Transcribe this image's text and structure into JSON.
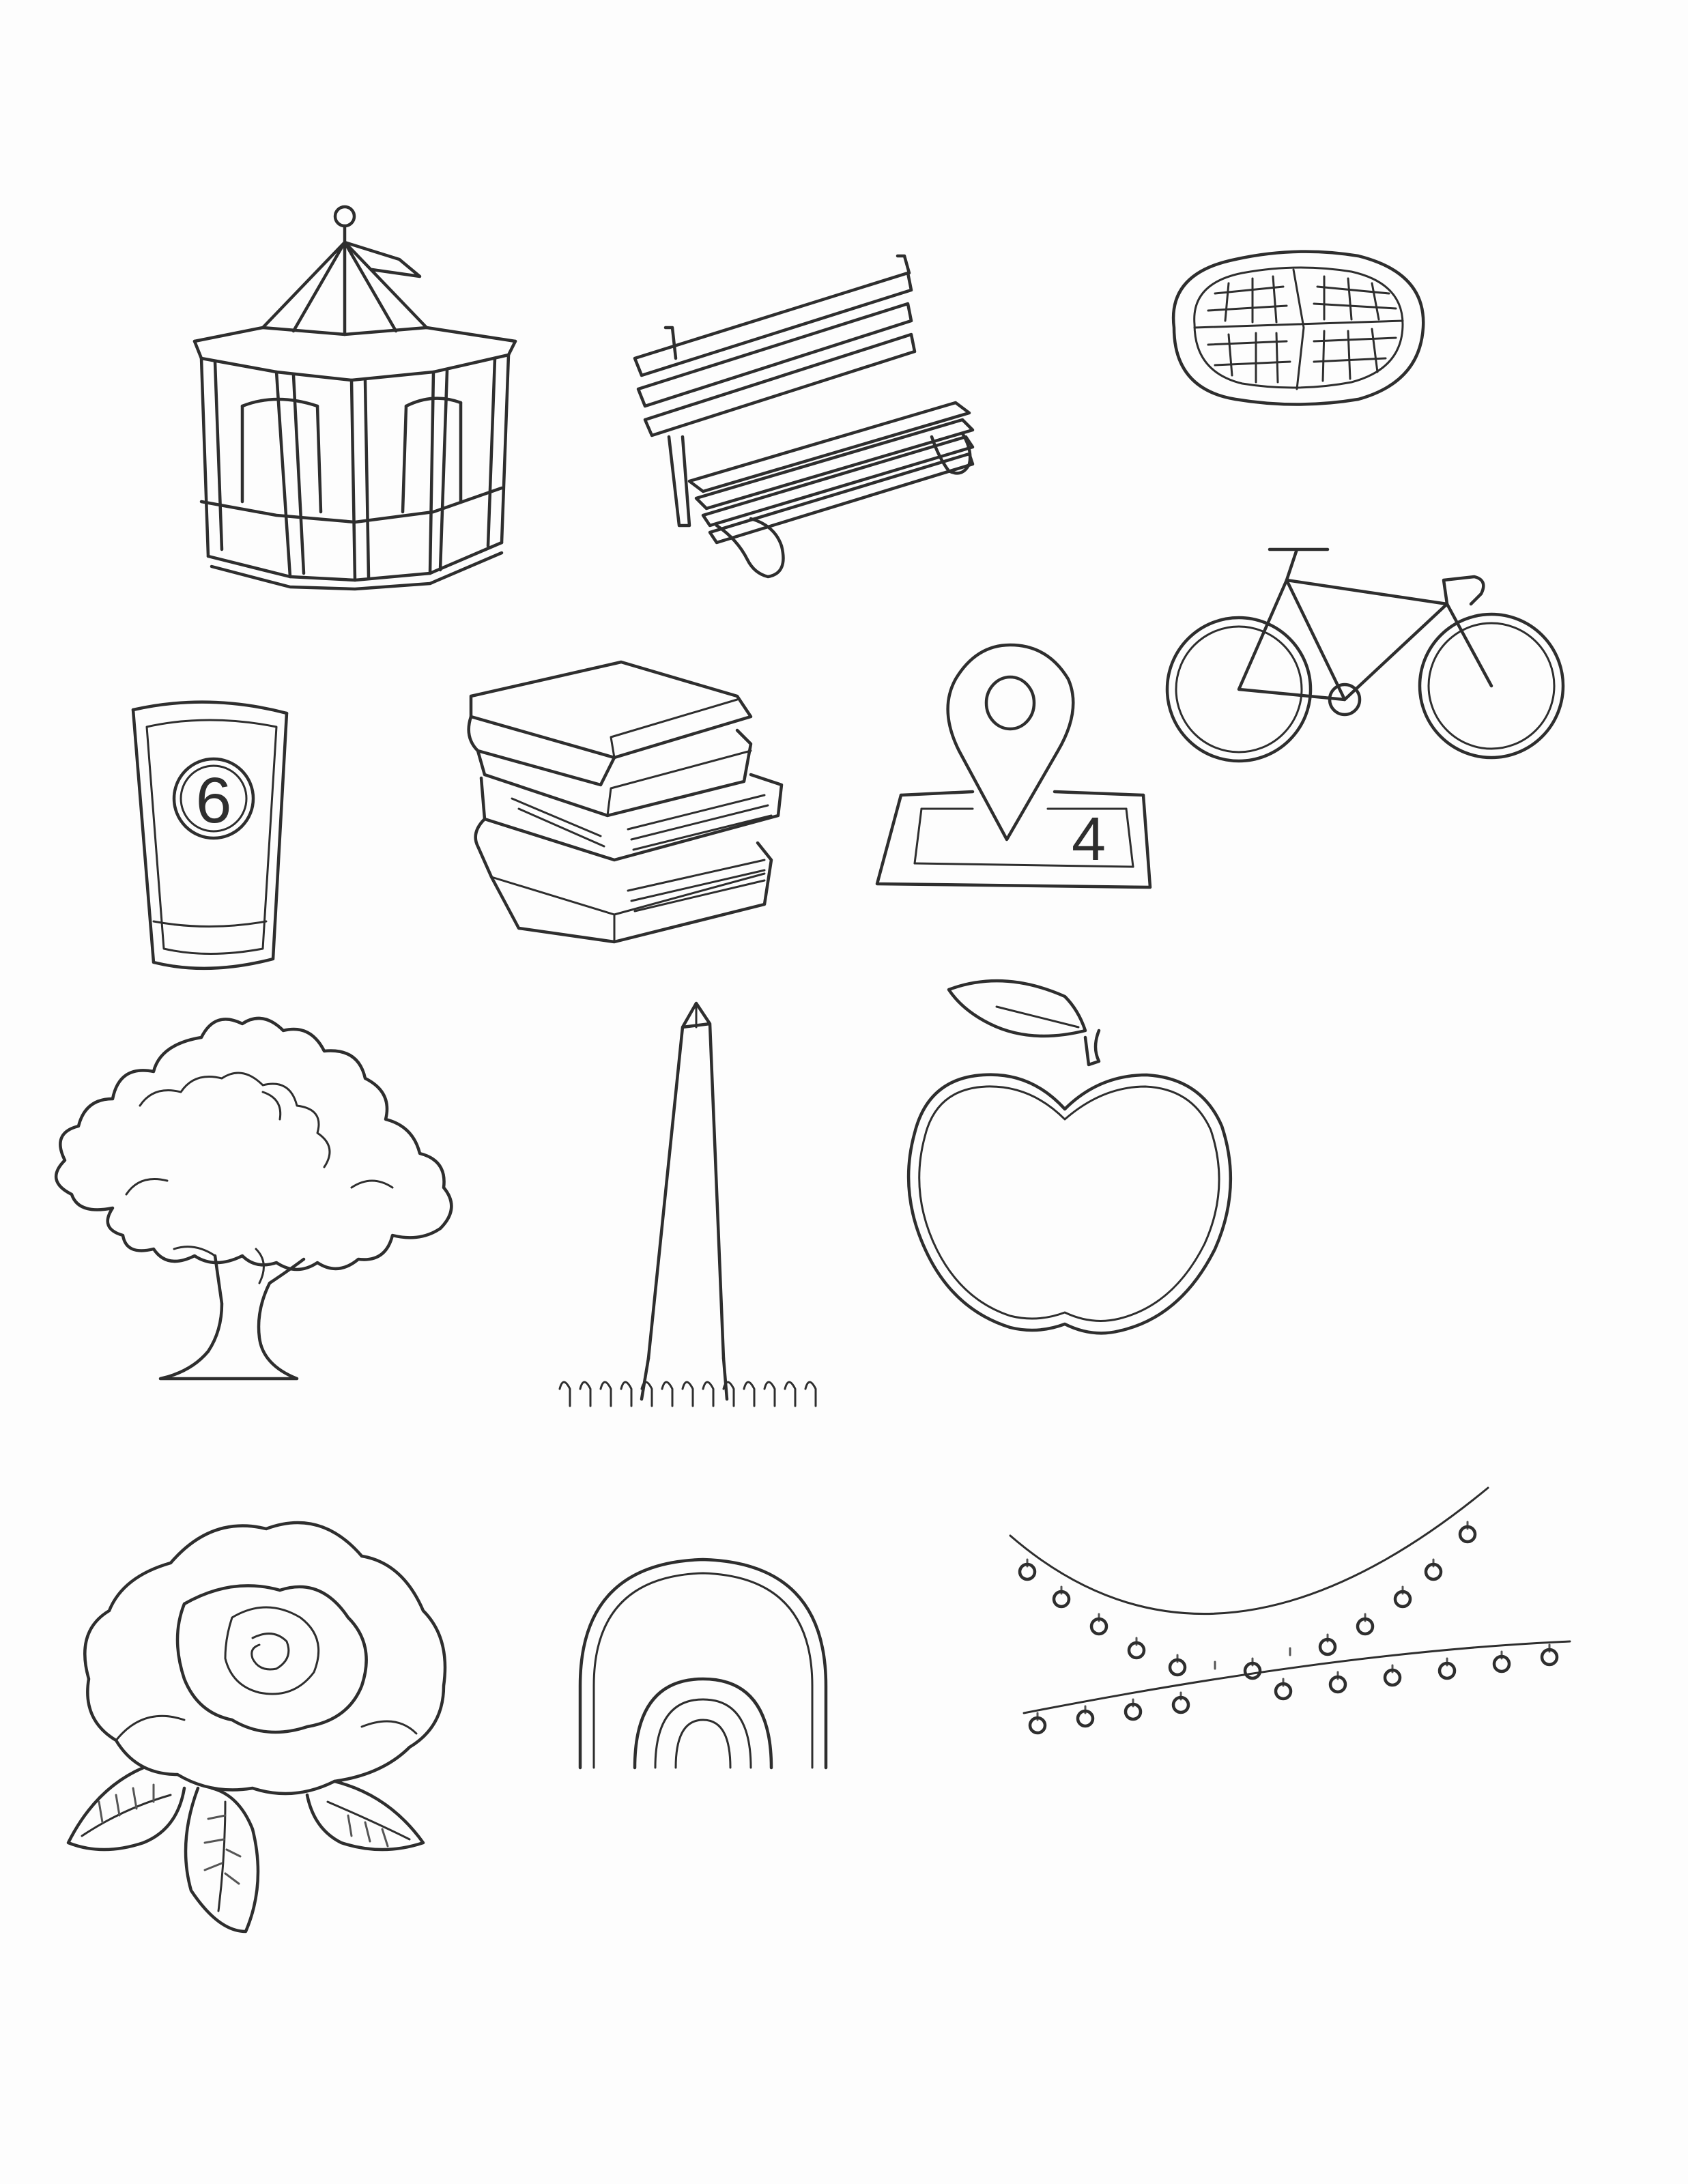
{
  "page": {
    "background_color": "#fdfdfd",
    "line_color": "#2e2e2e"
  },
  "drawings": [
    {
      "icon": "gazebo-icon"
    },
    {
      "icon": "park-bench-icon"
    },
    {
      "icon": "waffle-icon"
    },
    {
      "icon": "bicycle-icon"
    },
    {
      "icon": "cup-icon",
      "label": "6"
    },
    {
      "icon": "stacked-books-icon"
    },
    {
      "icon": "map-pin-icon",
      "label": "4"
    },
    {
      "icon": "tree-icon"
    },
    {
      "icon": "monument-icon"
    },
    {
      "icon": "apple-icon"
    },
    {
      "icon": "rose-icon"
    },
    {
      "icon": "rainbow-arch-icon"
    },
    {
      "icon": "string-lights-icon"
    }
  ]
}
